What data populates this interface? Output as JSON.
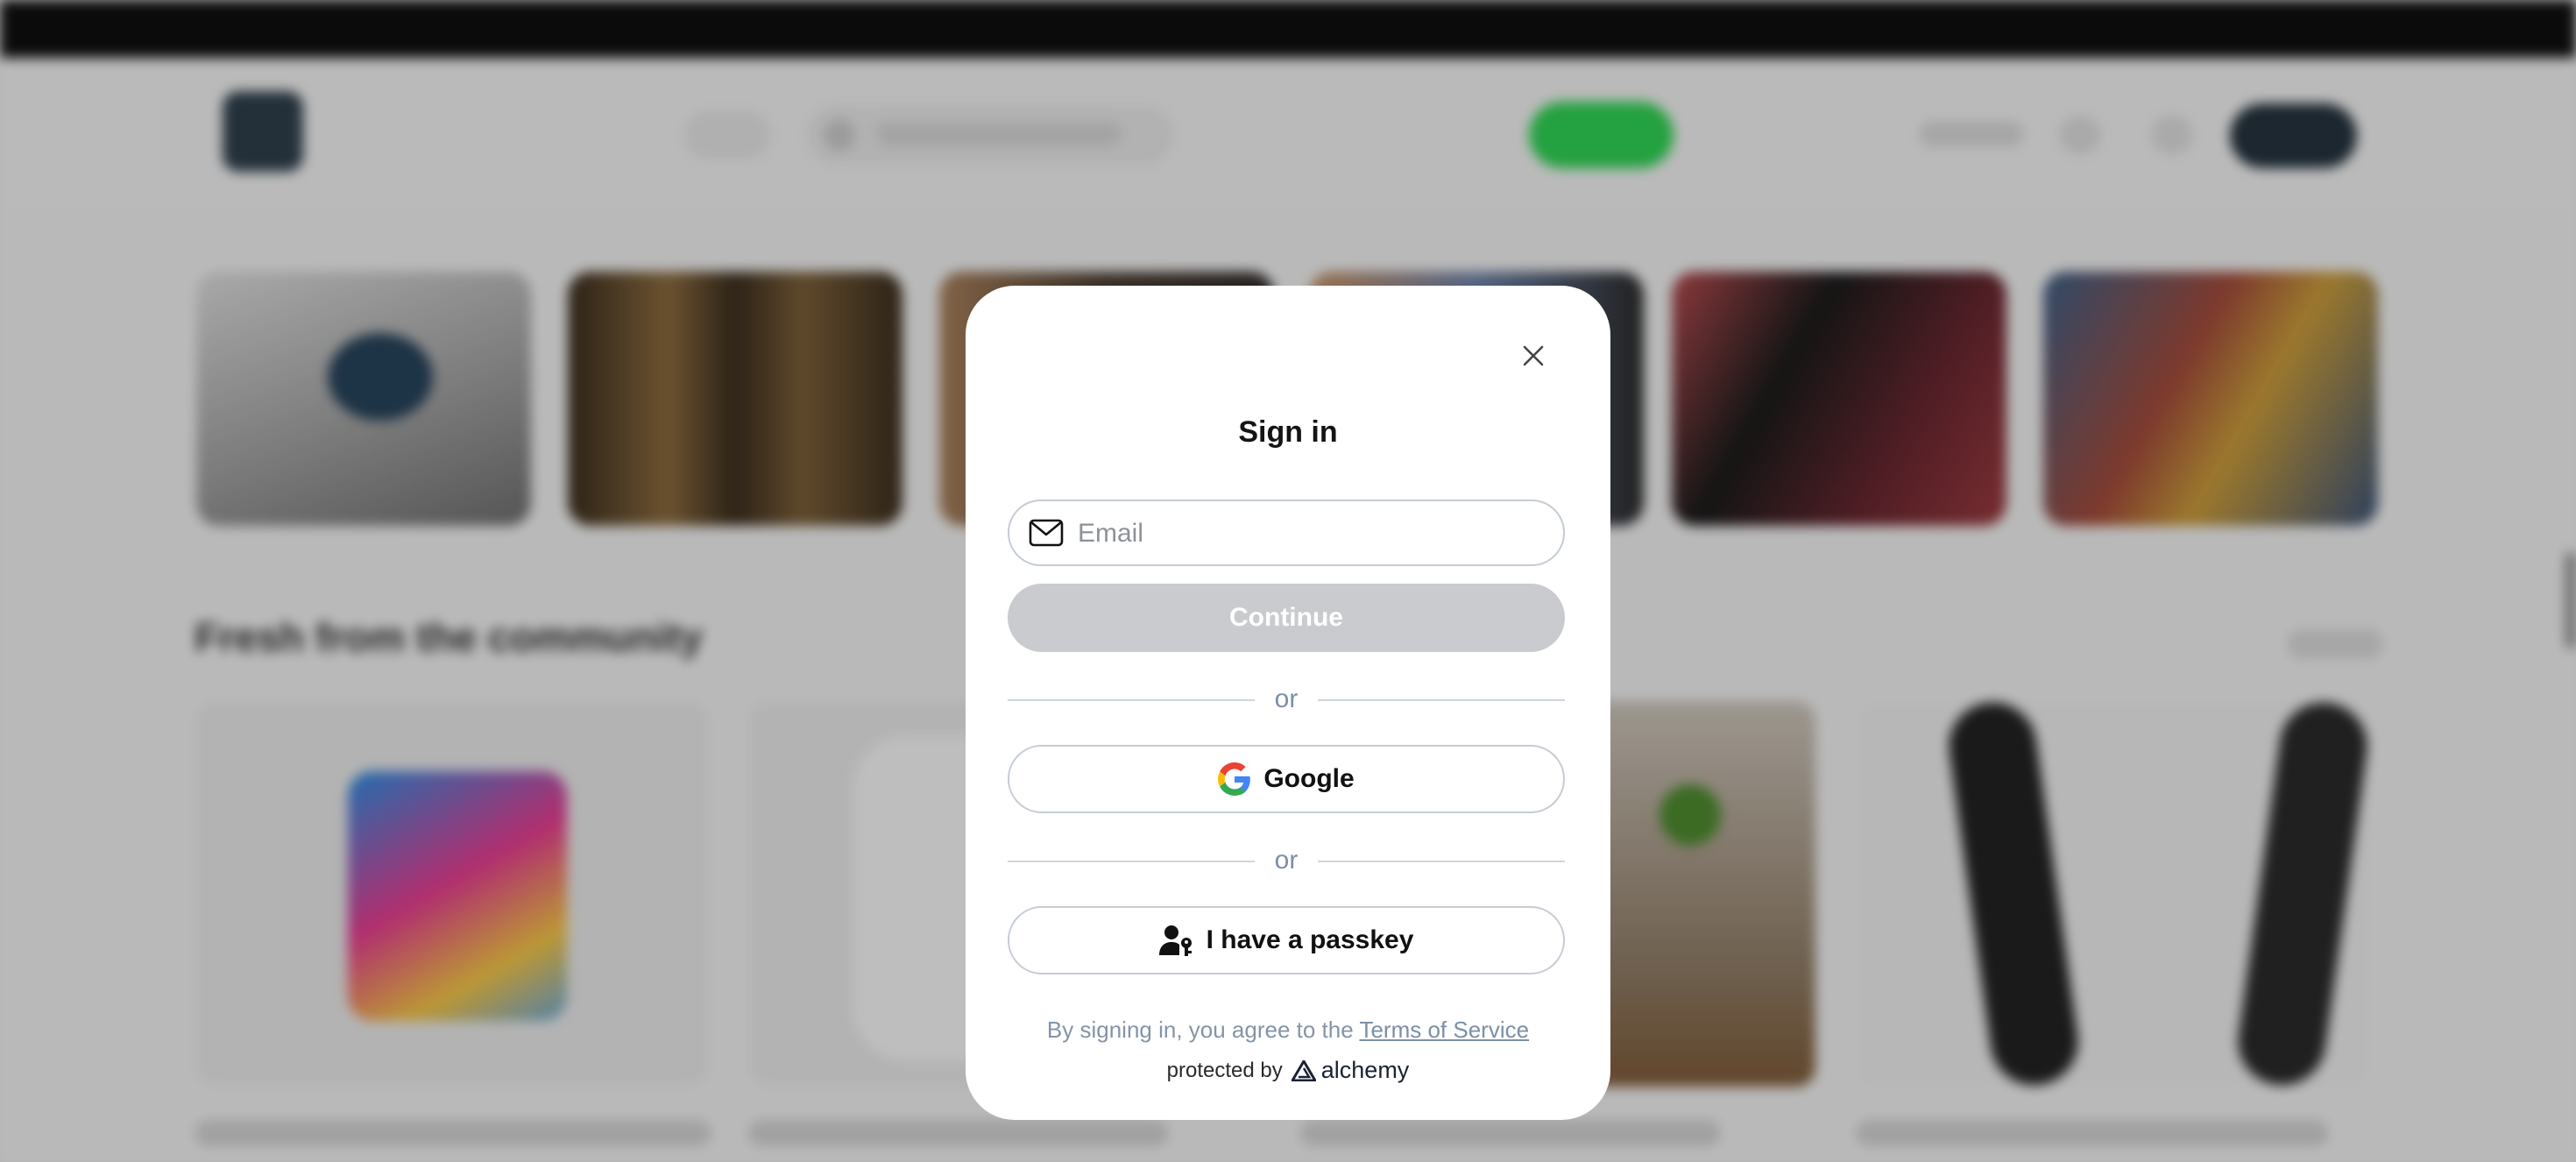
{
  "modal": {
    "title": "Sign in",
    "email_placeholder": "Email",
    "continue_label": "Continue",
    "or_label": "or",
    "google_label": "Google",
    "passkey_label": "I have a passkey",
    "terms_prefix": "By signing in, you agree to the ",
    "terms_link": "Terms of Service",
    "protected_by": "protected by",
    "protector_name": "alchemy"
  },
  "background": {
    "section_title": "Fresh from the community"
  },
  "icons": {
    "close": "close-icon",
    "email": "mail-icon",
    "google": "google-logo-icon",
    "passkey": "user-key-icon",
    "protector": "alchemy-logo-icon"
  },
  "colors": {
    "continue_disabled": "#c9cbcf",
    "muted_text": "#8494a8",
    "border": "#c6ccd6",
    "overlay": "rgba(0,0,0,0.22)"
  }
}
